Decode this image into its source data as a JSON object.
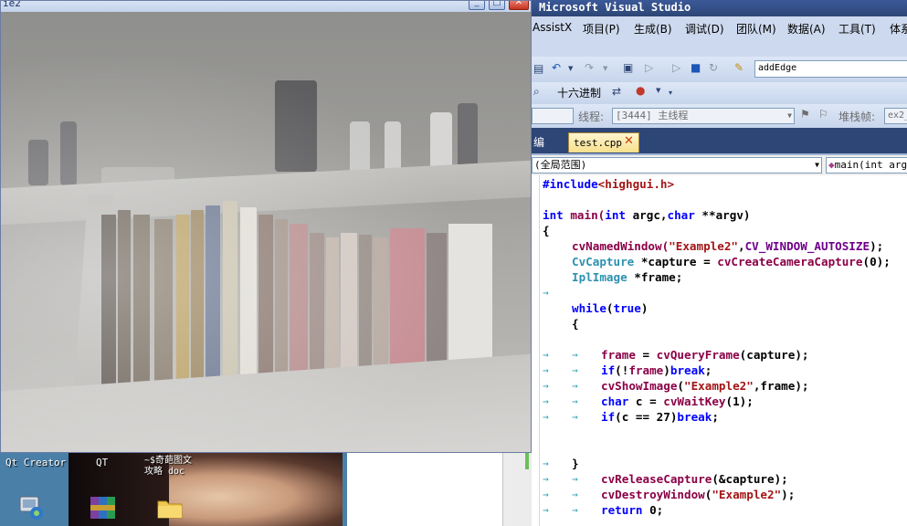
{
  "camera_window": {
    "title": "ie2",
    "min_glyph": "_",
    "max_glyph": "□",
    "close_glyph": "✕"
  },
  "desktop": {
    "icons": [
      {
        "label": "Qt Creator",
        "icon": "qt-creator-icon"
      },
      {
        "label": "QT",
        "icon": "winrar-icon"
      },
      {
        "label": "~$奇葩图文\n攻略 doc",
        "icon": "folder-icon"
      }
    ]
  },
  "vs": {
    "title": "Microsoft Visual Studio",
    "menu": [
      "AssistX",
      "项目(P)",
      "生成(B)",
      "调试(D)",
      "团队(M)",
      "数据(A)",
      "工具(T)",
      "体系"
    ],
    "toolbar1": {
      "search_value": "addEdge"
    },
    "toolbar2": {
      "hex_label": "十六进制"
    },
    "toolbar3": {
      "thread_label": "线程:",
      "thread_value": "[3444] 主线程",
      "stack_label": "堆栈帧:",
      "stack_value": "ex2_"
    },
    "tabs": {
      "edit_label": "编",
      "active_tab": "test.cpp",
      "close_glyph": "✕"
    },
    "nav": {
      "scope": "(全局范围)",
      "member": "main(int arg"
    },
    "code": [
      {
        "segments": [
          {
            "t": "#include",
            "c": "kw"
          },
          {
            "t": "<highgui.h>",
            "c": "st"
          }
        ],
        "indent": 0
      },
      {
        "segments": [],
        "indent": 0
      },
      {
        "segments": [
          {
            "t": "int",
            "c": "kw"
          },
          {
            "t": " main(",
            "c": "fn"
          },
          {
            "t": "int",
            "c": "kw"
          },
          {
            "t": " argc,",
            "c": ""
          },
          {
            "t": "char",
            "c": "kw"
          },
          {
            "t": " **argv)",
            "c": ""
          }
        ],
        "indent": 0
      },
      {
        "segments": [
          {
            "t": "{",
            "c": ""
          }
        ],
        "indent": 0
      },
      {
        "segments": [
          {
            "t": "cvNamedWindow(",
            "c": "fn"
          },
          {
            "t": "\"Example2\"",
            "c": "st"
          },
          {
            "t": ",",
            "c": ""
          },
          {
            "t": "CV_WINDOW_AUTOSIZE",
            "c": "mac"
          },
          {
            "t": ");",
            "c": ""
          }
        ],
        "indent": 1
      },
      {
        "segments": [
          {
            "t": "CvCapture",
            "c": "ty"
          },
          {
            "t": " *capture = ",
            "c": ""
          },
          {
            "t": "cvCreateCameraCapture",
            "c": "fn"
          },
          {
            "t": "(0);",
            "c": ""
          }
        ],
        "indent": 1
      },
      {
        "segments": [
          {
            "t": "IplImage",
            "c": "ty"
          },
          {
            "t": " *frame;",
            "c": ""
          }
        ],
        "indent": 1
      },
      {
        "segments": [],
        "indent": 1,
        "tab": true
      },
      {
        "segments": [
          {
            "t": "while",
            "c": "kw"
          },
          {
            "t": "(",
            "c": ""
          },
          {
            "t": "true",
            "c": "kw"
          },
          {
            "t": ")",
            "c": ""
          }
        ],
        "indent": 1
      },
      {
        "segments": [
          {
            "t": "{",
            "c": ""
          }
        ],
        "indent": 1
      },
      {
        "segments": [],
        "indent": 0
      },
      {
        "segments": [
          {
            "t": "frame",
            "c": "fn"
          },
          {
            "t": " = ",
            "c": ""
          },
          {
            "t": "cvQueryFrame",
            "c": "fn"
          },
          {
            "t": "(capture);",
            "c": ""
          }
        ],
        "indent": 2,
        "tab": true
      },
      {
        "segments": [
          {
            "t": "if",
            "c": "kw"
          },
          {
            "t": "(!",
            "c": ""
          },
          {
            "t": "frame",
            "c": "fn"
          },
          {
            "t": ")",
            "c": ""
          },
          {
            "t": "break",
            "c": "kw"
          },
          {
            "t": ";",
            "c": ""
          }
        ],
        "indent": 2,
        "tab": true
      },
      {
        "segments": [
          {
            "t": "cvShowImage",
            "c": "fn"
          },
          {
            "t": "(",
            "c": ""
          },
          {
            "t": "\"Example2\"",
            "c": "st"
          },
          {
            "t": ",frame);",
            "c": ""
          }
        ],
        "indent": 2,
        "tab": true
      },
      {
        "segments": [
          {
            "t": "char",
            "c": "kw"
          },
          {
            "t": " c = ",
            "c": ""
          },
          {
            "t": "cvWaitKey",
            "c": "fn"
          },
          {
            "t": "(1);",
            "c": ""
          }
        ],
        "indent": 2,
        "tab": true
      },
      {
        "segments": [
          {
            "t": "if",
            "c": "kw"
          },
          {
            "t": "(c == 27)",
            "c": ""
          },
          {
            "t": "break",
            "c": "kw"
          },
          {
            "t": ";",
            "c": ""
          }
        ],
        "indent": 2,
        "tab": true
      },
      {
        "segments": [],
        "indent": 0
      },
      {
        "segments": [],
        "indent": 0
      },
      {
        "segments": [
          {
            "t": "}",
            "c": ""
          }
        ],
        "indent": 1,
        "tab": true
      },
      {
        "segments": [
          {
            "t": "cvReleaseCapture",
            "c": "fn"
          },
          {
            "t": "(&capture);",
            "c": ""
          }
        ],
        "indent": 2,
        "tab": true
      },
      {
        "segments": [
          {
            "t": "cvDestroyWindow",
            "c": "fn"
          },
          {
            "t": "(",
            "c": ""
          },
          {
            "t": "\"Example2\"",
            "c": "st"
          },
          {
            "t": ");",
            "c": ""
          }
        ],
        "indent": 2,
        "tab": true
      },
      {
        "segments": [
          {
            "t": "return",
            "c": "kw"
          },
          {
            "t": " 0;",
            "c": ""
          }
        ],
        "indent": 2,
        "tab": true
      }
    ]
  }
}
